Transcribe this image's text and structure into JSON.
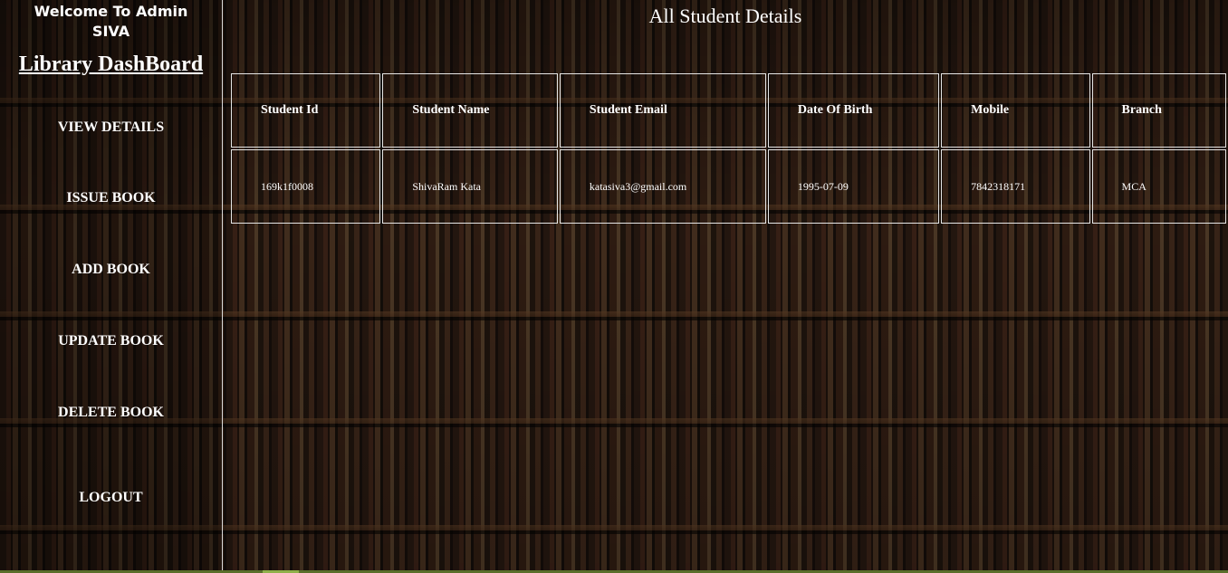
{
  "sidebar": {
    "welcome_line1": "Welcome To Admin",
    "welcome_line2": "SIVA",
    "brand": "Library DashBoard",
    "items": [
      {
        "label": "VIEW DETAILS"
      },
      {
        "label": "ISSUE BOOK"
      },
      {
        "label": "ADD BOOK"
      },
      {
        "label": "UPDATE BOOK"
      },
      {
        "label": "DELETE BOOK"
      },
      {
        "label": "LOGOUT"
      }
    ]
  },
  "main": {
    "title": "All Student Details",
    "table": {
      "columns": [
        "Student Id",
        "Student Name",
        "Student Email",
        "Date Of Birth",
        "Mobile",
        "Branch"
      ],
      "rows": [
        [
          "169k1f0008",
          "ShivaRam Kata",
          "katasiva3@gmail.com",
          "1995-07-09",
          "7842318171",
          "MCA"
        ]
      ]
    }
  }
}
